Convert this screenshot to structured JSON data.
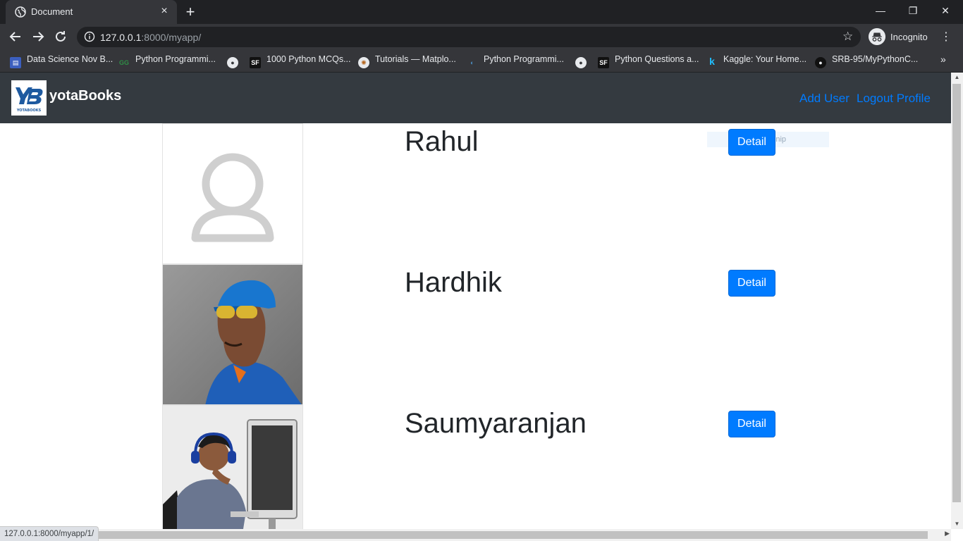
{
  "browser": {
    "tab_title": "Document",
    "new_tab_label": "+",
    "window_controls": {
      "minimize": "—",
      "restore": "❐",
      "close": "✕"
    },
    "url_host": "127.0.0.1",
    "url_rest": ":8000/myapp/",
    "profile_label": "Incognito",
    "bookmarks": [
      "Data Science Nov B...",
      "Python Programmi...",
      "",
      "1000 Python MCQs...",
      "Tutorials — Matplo...",
      "Python Programmi...",
      "",
      "Python Questions a...",
      "Kaggle: Your Home...",
      "SRB-95/MyPythonC..."
    ],
    "bookmarks_overflow": "»",
    "status_url": "127.0.0.1:8000/myapp/1/"
  },
  "page": {
    "brand": {
      "logo_text": "YB",
      "logo_caption": "YOTABOOKS",
      "name": "yotaBooks"
    },
    "nav_links": [
      "Add User",
      "Logout Profile"
    ],
    "detail_label": "Detail",
    "snip_hint": "Snip",
    "users": [
      {
        "name": "Rahul"
      },
      {
        "name": "Hardhik"
      },
      {
        "name": "Saumyaranjan"
      }
    ]
  },
  "colors": {
    "navbar_bg": "#343a40",
    "link": "#007bff",
    "button": "#007bff",
    "chrome_dark": "#202124",
    "chrome_toolbar": "#35363a"
  }
}
